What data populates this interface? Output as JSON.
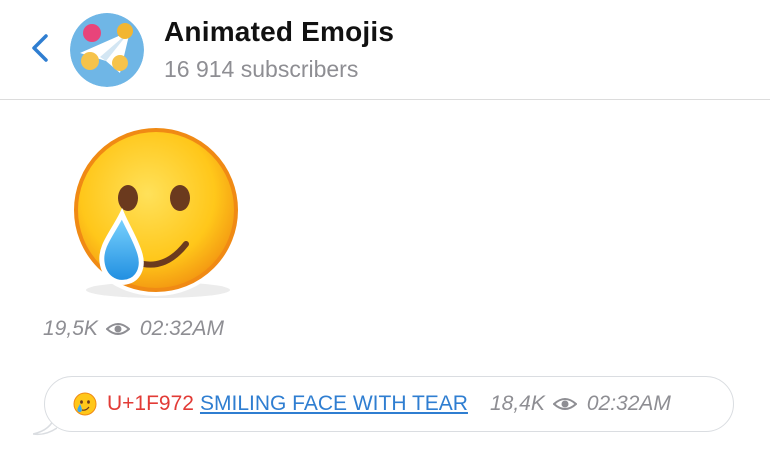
{
  "header": {
    "back_icon": "chevron-left-icon",
    "avatar_icon": "channel-avatar-icon",
    "title": "Animated Emojis",
    "subtitle": "16 914 subscribers"
  },
  "sticker_message": {
    "icon": "smiling-face-with-tear-icon",
    "views": "19,5K",
    "time": "02:32AM"
  },
  "text_message": {
    "icon": "smiling-face-with-tear-icon",
    "codepoint": "U+1F972",
    "name": "SMILING FACE WITH TEAR",
    "views": "18,4K",
    "time": "02:32AM"
  },
  "colors": {
    "accent": "#2f7ed1",
    "codepoint": "#e23b36",
    "meta": "#8e8e93"
  }
}
